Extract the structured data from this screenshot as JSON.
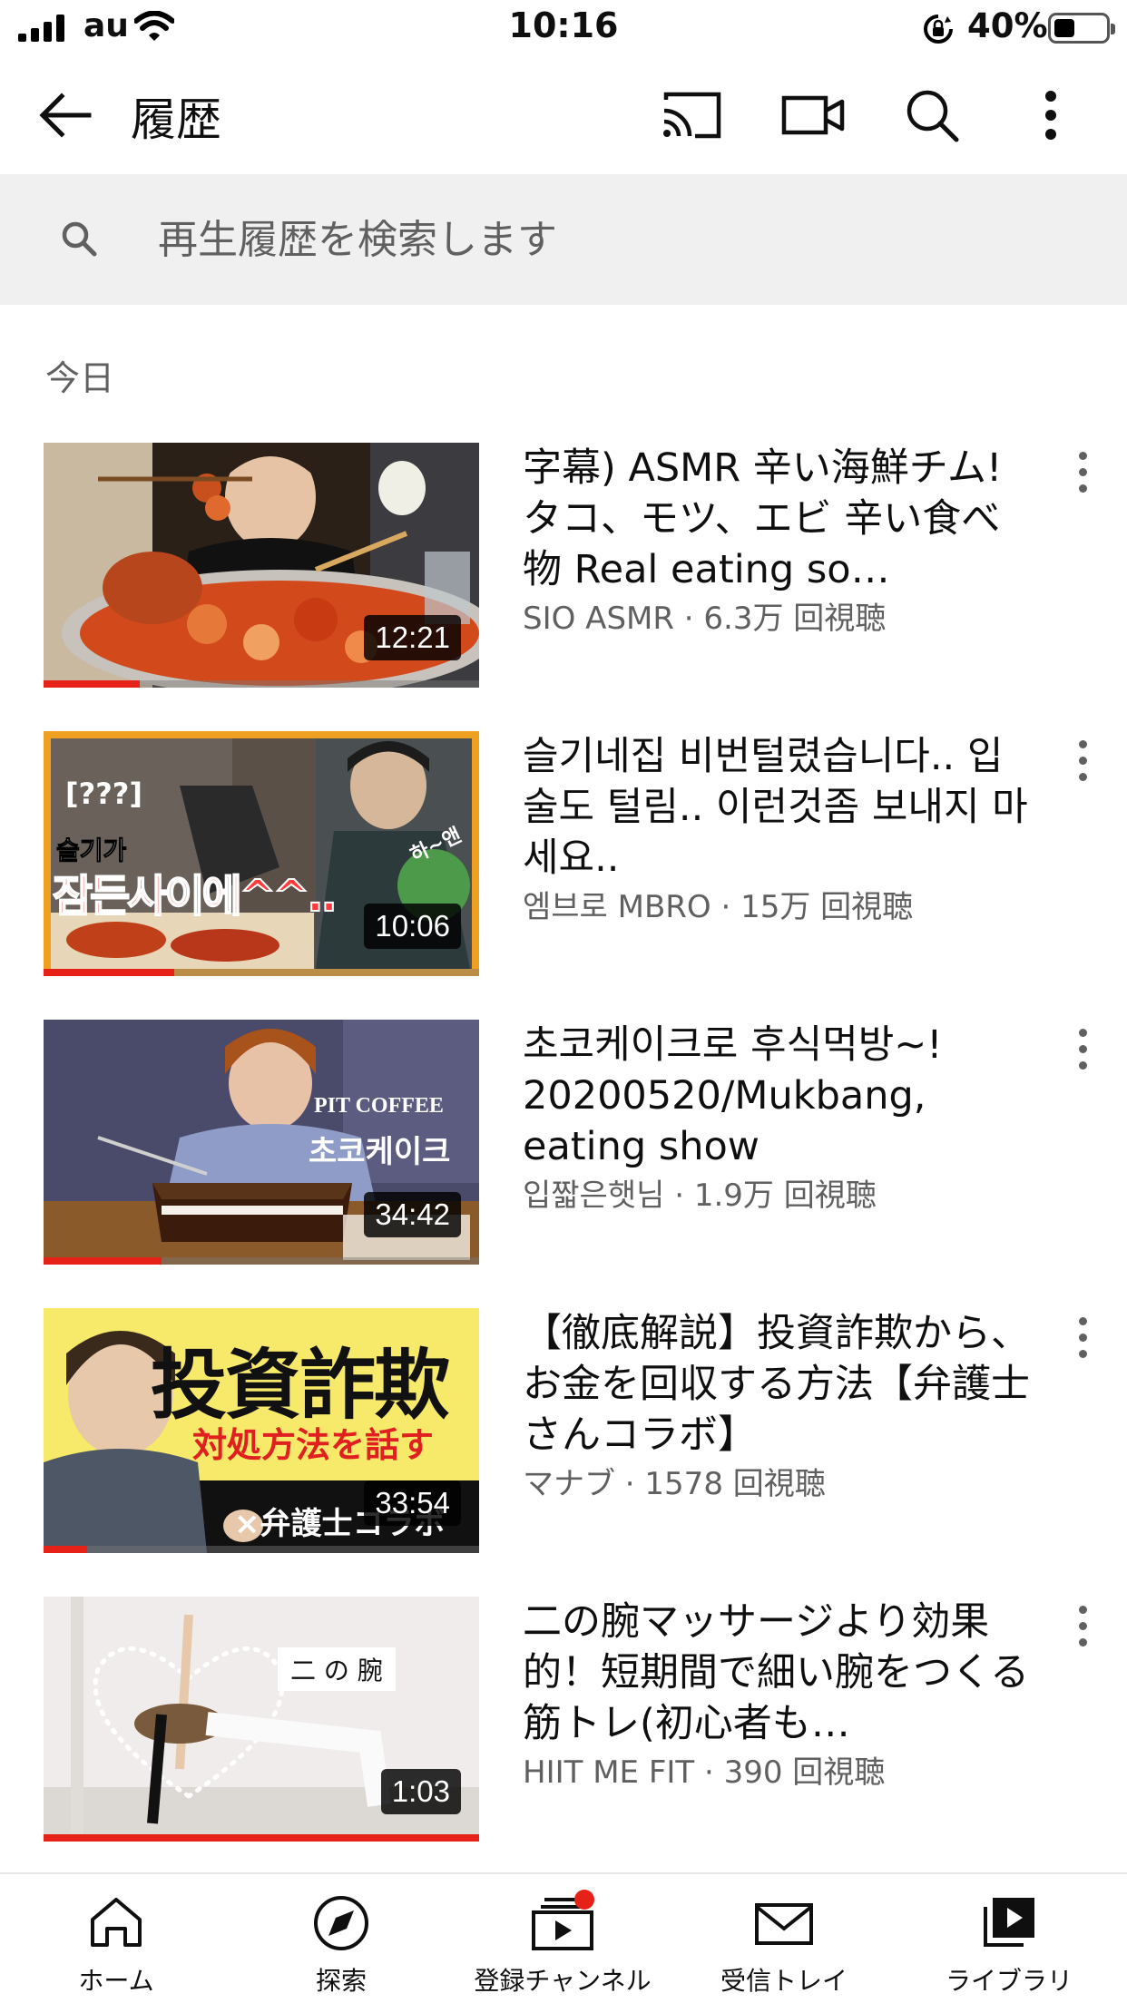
{
  "status_bar": {
    "carrier": "au",
    "time": "10:16",
    "battery": "40%"
  },
  "header": {
    "title": "履歴"
  },
  "search": {
    "placeholder": "再生履歴を検索します"
  },
  "section": {
    "label": "今日"
  },
  "videos": [
    {
      "title": "字幕) ASMR 辛い海鮮チム! タコ、モツ、エビ 辛い食べ物 Real eating so…",
      "channel_line": "SIO ASMR · 6.3万 回視聴",
      "duration": "12:21",
      "watched": 0.22
    },
    {
      "title": "슬기네집 비번털렸습니다.. 입술도 털림.. 이런것좀 보내지 마세요..",
      "channel_line": "엠브로 MBRO · 15万 回視聴",
      "duration": "10:06",
      "watched": 0.3,
      "thumb_text": [
        "[???]",
        "슬기가",
        "잠든사이에^^..",
        "하~앤"
      ]
    },
    {
      "title": "초코케이크로 후식먹방~! 20200520/Mukbang, eating show",
      "channel_line": "입짧은햇님 · 1.9万 回視聴",
      "duration": "34:42",
      "watched": 0.27,
      "thumb_text": [
        "PIT COFFEE",
        "초코케이크"
      ]
    },
    {
      "title": "【徹底解説】投資詐欺から、お金を回収する方法【弁護士さんコラボ】",
      "channel_line": "マナブ · 1578 回視聴",
      "duration": "33:54",
      "watched": 0.1,
      "thumb_text": [
        "投資詐欺",
        "対処方法を話す",
        "×弁護士コラボ"
      ]
    },
    {
      "title": "二の腕マッサージより効果的！短期間で細い腕をつくる筋トレ(初心者も…",
      "channel_line": "HIIT ME FIT · 390 回視聴",
      "duration": "1:03",
      "watched": 1.0,
      "thumb_text": [
        "二 の 腕"
      ]
    }
  ],
  "bottom_nav": [
    {
      "label": "ホーム",
      "icon": "home-icon"
    },
    {
      "label": "探索",
      "icon": "explore-icon"
    },
    {
      "label": "登録チャンネル",
      "icon": "subscriptions-icon"
    },
    {
      "label": "受信トレイ",
      "icon": "inbox-icon"
    },
    {
      "label": "ライブラリ",
      "icon": "library-icon"
    }
  ],
  "colors": {
    "accent": "#e62117",
    "search_bg": "#f0f0f0",
    "secondary_text": "#606060"
  }
}
